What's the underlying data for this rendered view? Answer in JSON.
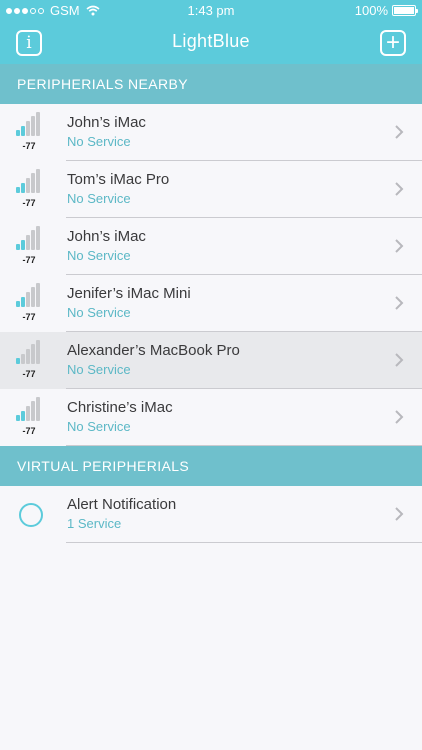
{
  "status_bar": {
    "carrier": "GSM",
    "time": "1:43 pm",
    "battery": "100%",
    "battery_level": 1.0,
    "signal_dots_on": 3,
    "signal_dots_total": 5
  },
  "nav": {
    "title": "LightBlue",
    "info_icon": "info-icon",
    "add_icon": "plus-icon"
  },
  "sections": {
    "nearby_title": "PERIPHERIALS NEARBY",
    "virtual_title": "VIRTUAL PERIPHERIALS"
  },
  "peripherals": [
    {
      "name": "John’s iMac",
      "service": "No Service",
      "rssi": "-77",
      "bars_on": 2
    },
    {
      "name": "Tom’s iMac Pro",
      "service": "No Service",
      "rssi": "-77",
      "bars_on": 2
    },
    {
      "name": "John’s iMac",
      "service": "No Service",
      "rssi": "-77",
      "bars_on": 2
    },
    {
      "name": "Jenifer’s iMac Mini",
      "service": "No Service",
      "rssi": "-77",
      "bars_on": 2
    },
    {
      "name": "Alexander’s MacBook Pro",
      "service": "No Service",
      "rssi": "-77",
      "bars_on": 1
    },
    {
      "name": "Christine’s iMac",
      "service": "No Service",
      "rssi": "-77",
      "bars_on": 2
    }
  ],
  "virtual": [
    {
      "name": "Alert Notification",
      "service": "1 Service"
    }
  ],
  "colors": {
    "accent": "#5ccbdb",
    "section": "#6fc0cc",
    "subtitle": "#5cb8c6",
    "highlight_row": "#e8e9ec"
  }
}
